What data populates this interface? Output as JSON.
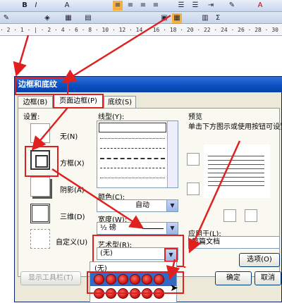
{
  "toolbar": {
    "buttons": [
      "B",
      "I",
      "A",
      "Σ",
      "A"
    ]
  },
  "ruler": {
    "text": "· 2 · 1 · |  · 2 · 4 · 6 · 8 · 10 · 12 · 14 · 16 · 18 · 20 · 22 · 24 · 26 · 28 · 30 · 32"
  },
  "dialog": {
    "title": "边框和底纹",
    "tabs": [
      "边框(B)",
      "页面边框(P)",
      "底纹(S)"
    ],
    "settings_label": "设置:",
    "settings": [
      "无(N)",
      "方框(X)",
      "阴影(A)",
      "三维(D)",
      "自定义(U)"
    ],
    "line_style_label": "线型(Y):",
    "color_label": "颜色(C):",
    "color_value": "自动",
    "width_label": "宽度(W):",
    "width_value": "½ 磅",
    "art_label": "艺术型(R):",
    "art_value": "(无)",
    "art_option": "(无)",
    "preview_label": "预览",
    "preview_hint": "单击下方图示或使用按钮可设置",
    "apply_label": "应用于(L):",
    "apply_value": "整篇文档",
    "options_button": "选项(O)",
    "show_toolbar_button": "显示工具栏(T)",
    "ok_button": "确定",
    "cancel_button": "取消"
  },
  "colors": {
    "accent_red": "#e02020",
    "titlebar": "#0b4fc0"
  }
}
